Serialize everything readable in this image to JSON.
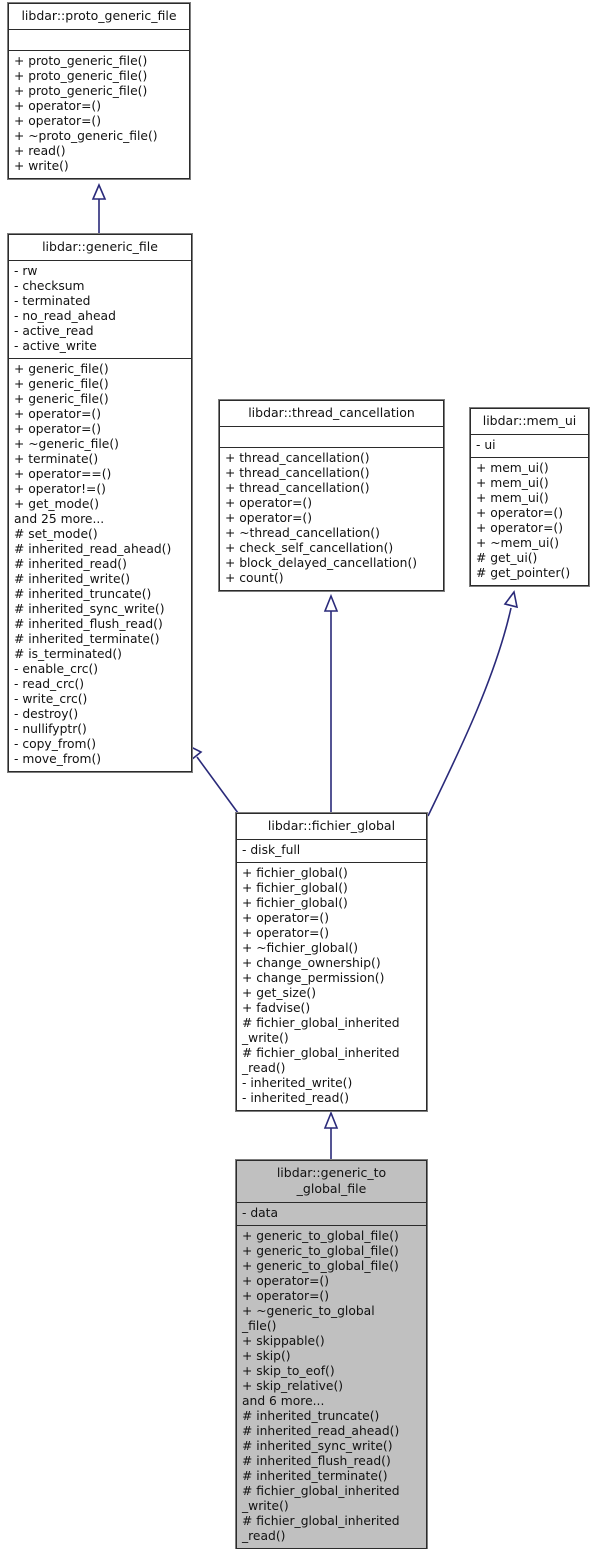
{
  "diagram": {
    "kind": "uml-class-inheritance-diagram",
    "colors": {
      "box_border": "#2b2b2b",
      "box_fill": "#ffffff",
      "highlight_fill": "#c0c0c0",
      "edge": "#2a2a7a",
      "text": "#111111"
    },
    "classes": [
      {
        "id": "proto_generic_file",
        "title": "libdar::proto_generic_file",
        "highlighted": false,
        "attributes": [],
        "operations": [
          "+ proto_generic_file()",
          "+ proto_generic_file()",
          "+ proto_generic_file()",
          "+ operator=()",
          "+ operator=()",
          "+ ~proto_generic_file()",
          "+ read()",
          "+ write()"
        ]
      },
      {
        "id": "generic_file",
        "title": "libdar::generic_file",
        "highlighted": false,
        "attributes": [
          "- rw",
          "- checksum",
          "- terminated",
          "- no_read_ahead",
          "- active_read",
          "- active_write"
        ],
        "operations": [
          "+ generic_file()",
          "+ generic_file()",
          "+ generic_file()",
          "+ operator=()",
          "+ operator=()",
          "+ ~generic_file()",
          "+ terminate()",
          "+ operator==()",
          "+ operator!=()",
          "+ get_mode()",
          "and 25 more...",
          "# set_mode()",
          "# inherited_read_ahead()",
          "# inherited_read()",
          "# inherited_write()",
          "# inherited_truncate()",
          "# inherited_sync_write()",
          "# inherited_flush_read()",
          "# inherited_terminate()",
          "# is_terminated()",
          "- enable_crc()",
          "- read_crc()",
          "- write_crc()",
          "- destroy()",
          "- nullifyptr()",
          "- copy_from()",
          "- move_from()"
        ]
      },
      {
        "id": "thread_cancellation",
        "title": "libdar::thread_cancellation",
        "highlighted": false,
        "attributes": [],
        "operations": [
          "+ thread_cancellation()",
          "+ thread_cancellation()",
          "+ thread_cancellation()",
          "+ operator=()",
          "+ operator=()",
          "+ ~thread_cancellation()",
          "+ check_self_cancellation()",
          "+ block_delayed_cancellation()",
          "+ count()"
        ]
      },
      {
        "id": "mem_ui",
        "title": "libdar::mem_ui",
        "highlighted": false,
        "attributes": [
          "- ui"
        ],
        "operations": [
          "+ mem_ui()",
          "+ mem_ui()",
          "+ mem_ui()",
          "+ operator=()",
          "+ operator=()",
          "+ ~mem_ui()",
          "# get_ui()",
          "# get_pointer()"
        ]
      },
      {
        "id": "fichier_global",
        "title": "libdar::fichier_global",
        "highlighted": false,
        "attributes": [
          "- disk_full"
        ],
        "operations": [
          "+ fichier_global()",
          "+ fichier_global()",
          "+ fichier_global()",
          "+ operator=()",
          "+ operator=()",
          "+ ~fichier_global()",
          "+ change_ownership()",
          "+ change_permission()",
          "+ get_size()",
          "+ fadvise()",
          "# fichier_global_inherited\n_write()",
          "# fichier_global_inherited\n_read()",
          "- inherited_write()",
          "- inherited_read()"
        ]
      },
      {
        "id": "generic_to_global_file",
        "title": "libdar::generic_to\n_global_file",
        "highlighted": true,
        "attributes": [
          "- data"
        ],
        "operations": [
          "+ generic_to_global_file()",
          "+ generic_to_global_file()",
          "+ generic_to_global_file()",
          "+ operator=()",
          "+ operator=()",
          "+ ~generic_to_global\n_file()",
          "+ skippable()",
          "+ skip()",
          "+ skip_to_eof()",
          "+ skip_relative()",
          "and 6 more...",
          "# inherited_truncate()",
          "# inherited_read_ahead()",
          "# inherited_sync_write()",
          "# inherited_flush_read()",
          "# inherited_terminate()",
          "# fichier_global_inherited\n_write()",
          "# fichier_global_inherited\n_read()"
        ]
      }
    ],
    "edges": [
      {
        "from": "generic_file",
        "to": "proto_generic_file",
        "type": "inheritance"
      },
      {
        "from": "fichier_global",
        "to": "generic_file",
        "type": "inheritance"
      },
      {
        "from": "fichier_global",
        "to": "thread_cancellation",
        "type": "inheritance"
      },
      {
        "from": "fichier_global",
        "to": "mem_ui",
        "type": "inheritance"
      },
      {
        "from": "generic_to_global_file",
        "to": "fichier_global",
        "type": "inheritance"
      }
    ]
  }
}
